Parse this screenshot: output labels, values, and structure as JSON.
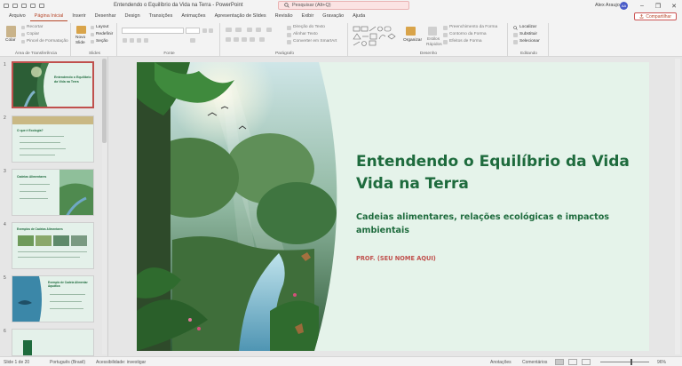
{
  "titlebar": {
    "doc_title": "Entendendo o Equilíbrio da Vida na Terra  -  PowerPoint",
    "search_placeholder": "Pesquisar (Alt+Q)",
    "user_name": "Alex Araujo",
    "avatar_initials": "AA"
  },
  "tabs": [
    "Arquivo",
    "Página Inicial",
    "Inserir",
    "Desenhar",
    "Design",
    "Transições",
    "Animações",
    "Apresentação de Slides",
    "Revisão",
    "Exibir",
    "Gravação",
    "Ajuda"
  ],
  "share_label": "Compartilhar",
  "ribbon": {
    "clipboard": {
      "label": "Área de Transferência",
      "paste": "Colar",
      "cut": "Recortar",
      "copy": "Copiar",
      "format_painter": "Pincel de Formatação"
    },
    "slides": {
      "label": "Slides",
      "new_slide_1": "Novo",
      "new_slide_2": "Slide",
      "layout": "Layout",
      "reset": "Redefinir",
      "section": "Seção"
    },
    "font": {
      "label": "Fonte"
    },
    "paragraph": {
      "label": "Parágrafo",
      "text_direction": "Direção do Texto",
      "align_text": "Alinhar Texto",
      "smartart": "Converter em SmartArt"
    },
    "drawing": {
      "label": "Desenho",
      "arrange": "Organizar",
      "quick_styles_1": "Estilos",
      "quick_styles_2": "Rápidos",
      "fill": "Preenchimento da Forma",
      "outline": "Contorno da Forma",
      "effects": "Efeitos de Forma"
    },
    "editing": {
      "label": "Editando",
      "find": "Localizar",
      "replace": "Substituir",
      "select": "Selecionar"
    }
  },
  "thumbnails": [
    {
      "num": "1",
      "title": "Entendendo o Equilíbrio da Vida na Terra"
    },
    {
      "num": "2",
      "title": "O que é Ecologia?"
    },
    {
      "num": "3",
      "title": "Cadeias Alimentares"
    },
    {
      "num": "4",
      "title": "Exemplos de Cadeias Alimentares"
    },
    {
      "num": "5",
      "title": "Exemplo de Cadeia Alimentar Aquática"
    },
    {
      "num": "6",
      "title": ""
    }
  ],
  "slide": {
    "title": "Entendendo o Equilíbrio da Vida Vida na Terra",
    "subtitle": "Cadeias alimentares, relações ecológicas e impactos ambientais",
    "author": "PROF. (SEU NOME AQUI)"
  },
  "status": {
    "slide_count": "Slide 1 de 20",
    "language": "Português (Brasil)",
    "accessibility": "Acessibilidade: investigar",
    "notes": "Anotações",
    "comments": "Comentários",
    "zoom": "96%"
  },
  "colors": {
    "accent": "#b7472a",
    "slide_title": "#1e6b3d",
    "author": "#c0504d"
  }
}
